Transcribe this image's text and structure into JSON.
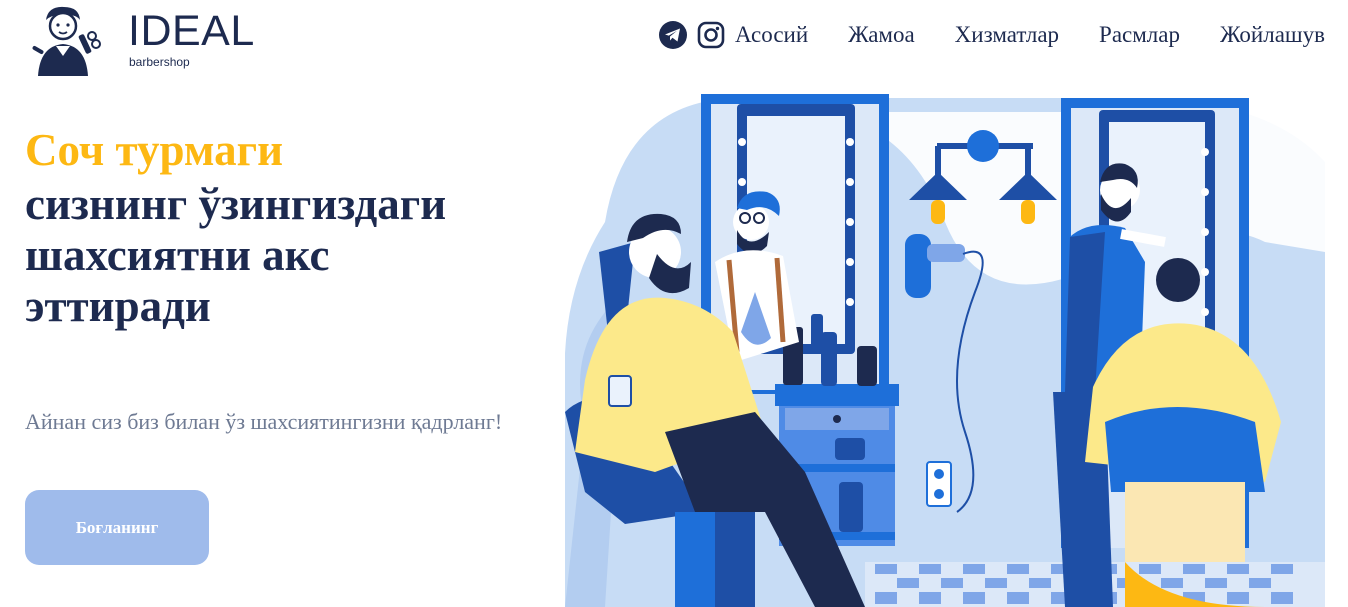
{
  "brand": {
    "name": "IDEAL",
    "tagline": "barbershop"
  },
  "nav": {
    "social": [
      {
        "icon": "telegram-icon"
      },
      {
        "icon": "instagram-icon"
      }
    ],
    "links": [
      {
        "label": "Асосий"
      },
      {
        "label": "Жамоа"
      },
      {
        "label": "Хизматлар"
      },
      {
        "label": "Расмлар"
      },
      {
        "label": "Жойлашув"
      }
    ]
  },
  "hero": {
    "accent": "Соч турмаги",
    "title_lines": [
      "сизнинг ўзингиздаги",
      "шахсиятни акс",
      "эттиради"
    ],
    "lead": "Айнан сиз биз билан ўз шахсиятингизни қадрланг!",
    "cta": "Боғланинг"
  },
  "colors": {
    "accent": "#fdb813",
    "navy": "#1d2a4f",
    "button": "#9fbbeb",
    "muted_text": "#6e7a93",
    "illustration_blue": "#1e6fd9",
    "illustration_sky": "#c7dcf5"
  }
}
